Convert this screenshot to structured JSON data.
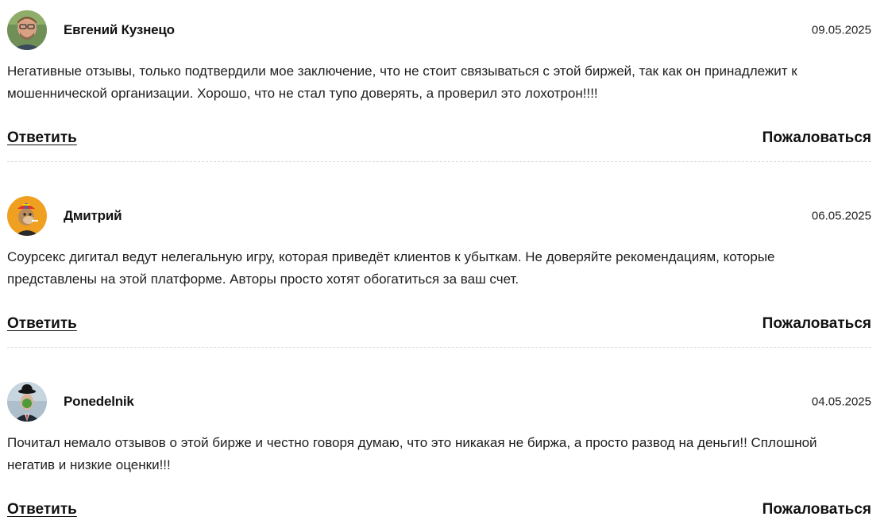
{
  "comments": [
    {
      "author": "Евгений Кузнецо",
      "date": "09.05.2025",
      "text": "Негативные отзывы, только подтвердили мое заключение, что не стоит связываться с этой биржей, так как он принадлежит к мошеннической организации. Хорошо, что не стал тупо доверять, а проверил это лохотрон!!!!",
      "reply_label": "Ответить",
      "report_label": "Пожаловаться"
    },
    {
      "author": "Дмитрий",
      "date": "06.05.2025",
      "text": "Соурсекс дигитал ведут нелегальную игру, которая приведёт клиентов к убыткам. Не доверяйте рекомендациям, которые представлены на этой платформе. Авторы просто хотят обогатиться за ваш счет.",
      "reply_label": "Ответить",
      "report_label": "Пожаловаться"
    },
    {
      "author": "Ponedelnik",
      "date": "04.05.2025",
      "text": "Почитал немало отзывов о этой бирже и честно говоря думаю, что это никакая не биржа, а просто развод на деньги!! Сплошной негатив и низкие оценки!!!",
      "reply_label": "Ответить",
      "report_label": "Пожаловаться"
    }
  ]
}
